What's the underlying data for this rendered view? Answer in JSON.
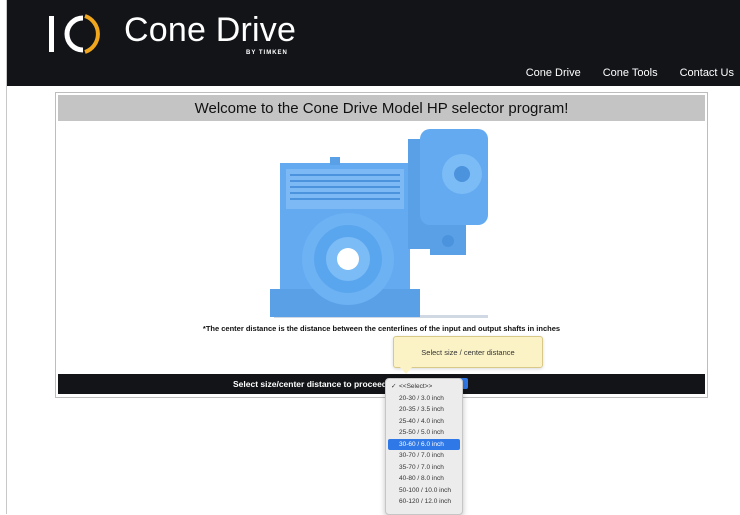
{
  "header": {
    "brand": "Cone Drive",
    "brand_sub": "BY TIMKEN",
    "nav": [
      "Cone Drive",
      "Cone Tools",
      "Contact Us"
    ]
  },
  "panel": {
    "title": "Welcome to the Cone Drive Model HP selector program!",
    "note": "*The center distance is the distance between the centerlines of the input and output shafts in inches",
    "tooltip": "Select size / center distance",
    "select_label": "Select size/center distance to proceed:"
  },
  "dropdown": {
    "selected": "<<Select>>",
    "highlighted": "30-60 / 6.0 inch",
    "options": [
      "<<Select>>",
      "20-30 / 3.0 inch",
      "20-35 / 3.5 inch",
      "25-40 / 4.0 inch",
      "25-50 / 5.0 inch",
      "30-60 / 6.0 inch",
      "30-70 / 7.0 inch",
      "35-70 / 7.0 inch",
      "40-80 / 8.0 inch",
      "50-100 / 10.0 inch",
      "60-120 / 12.0 inch"
    ]
  },
  "colors": {
    "header_bg": "#121418",
    "brand_accent": "#f0a71e",
    "product_blue": "#5aa6ee",
    "highlight": "#2f78e8",
    "title_bar": "#c4c4c4"
  },
  "icons": {
    "logo_mark": "cone-drive-logo-icon",
    "check": "checkmark-icon"
  }
}
